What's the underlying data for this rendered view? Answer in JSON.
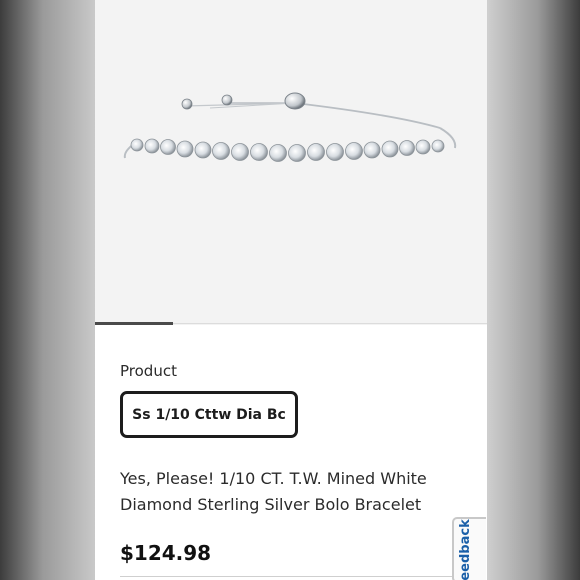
{
  "product_section": {
    "label": "Product",
    "selected_variant": "Ss 1/10 Cttw Dia Bc"
  },
  "product": {
    "title": "Yes, Please! 1/10 CT. T.W. Mined White Diamond Sterling Silver Bolo Bracelet",
    "price": "$124.98"
  },
  "feedback": {
    "label": "Feedback"
  },
  "colors": {
    "accent_link": "#1a5fa8",
    "chip_border": "#1c1c1c",
    "image_bg": "#f3f3f3"
  }
}
